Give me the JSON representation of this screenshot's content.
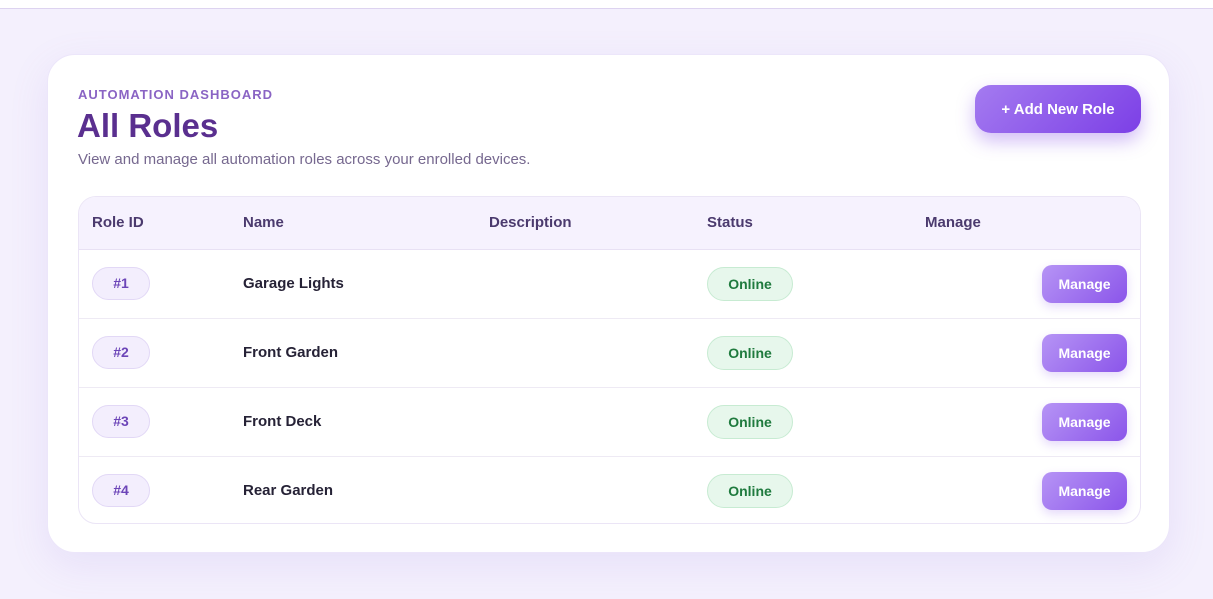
{
  "header": {
    "eyebrow": "AUTOMATION DASHBOARD",
    "title": "All Roles",
    "subtitle": "View and manage all automation roles across your enrolled devices.",
    "add_button_label": "+ Add New Role"
  },
  "table": {
    "columns": [
      "Role ID",
      "Name",
      "Description",
      "Status",
      "Manage"
    ],
    "rows": [
      {
        "id": "#1",
        "name": "Garage Lights",
        "description": "",
        "status": "Online",
        "action": "Manage"
      },
      {
        "id": "#2",
        "name": "Front Garden",
        "description": "",
        "status": "Online",
        "action": "Manage"
      },
      {
        "id": "#3",
        "name": "Front Deck",
        "description": "",
        "status": "Online",
        "action": "Manage"
      },
      {
        "id": "#4",
        "name": "Rear Garden",
        "description": "",
        "status": "Online",
        "action": "Manage"
      }
    ]
  },
  "colors": {
    "accent": "#7c3fe6",
    "title": "#5a2f8f",
    "status_online": "#1f7a3e",
    "background": "#f4f0fd"
  }
}
